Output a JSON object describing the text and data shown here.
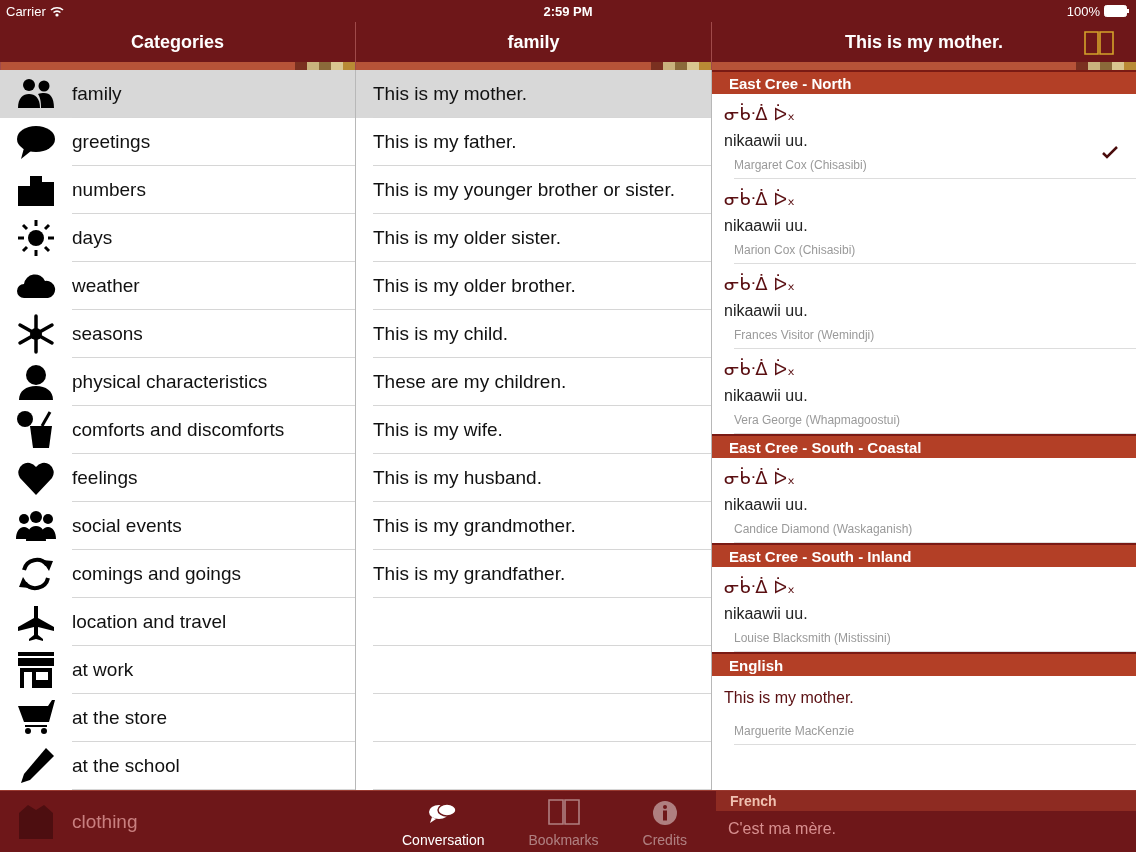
{
  "status_bar": {
    "carrier": "Carrier",
    "time": "2:59 PM",
    "battery": "100%"
  },
  "categories": {
    "title": "Categories",
    "items": [
      {
        "label": "family",
        "selected": true
      },
      {
        "label": "greetings",
        "selected": false
      },
      {
        "label": "numbers",
        "selected": false
      },
      {
        "label": "days",
        "selected": false
      },
      {
        "label": "weather",
        "selected": false
      },
      {
        "label": "seasons",
        "selected": false
      },
      {
        "label": "physical characteristics",
        "selected": false
      },
      {
        "label": "comforts and discomforts",
        "selected": false
      },
      {
        "label": "feelings",
        "selected": false
      },
      {
        "label": "social events",
        "selected": false
      },
      {
        "label": "comings and goings",
        "selected": false
      },
      {
        "label": "location and travel",
        "selected": false
      },
      {
        "label": "at work",
        "selected": false
      },
      {
        "label": "at the store",
        "selected": false
      },
      {
        "label": "at the school",
        "selected": false
      },
      {
        "label": "clothing",
        "selected": false
      }
    ]
  },
  "phrases": {
    "title": "family",
    "items": [
      {
        "label": "This is my mother.",
        "selected": true
      },
      {
        "label": "This is my father.",
        "selected": false
      },
      {
        "label": "This is my younger brother or sister.",
        "selected": false
      },
      {
        "label": "This is my older sister.",
        "selected": false
      },
      {
        "label": "This is my older brother.",
        "selected": false
      },
      {
        "label": "This is my child.",
        "selected": false
      },
      {
        "label": "These are my children.",
        "selected": false
      },
      {
        "label": "This is my wife.",
        "selected": false
      },
      {
        "label": "This is my husband.",
        "selected": false
      },
      {
        "label": "This is my grandmother.",
        "selected": false
      },
      {
        "label": "This is my grandfather.",
        "selected": false
      }
    ]
  },
  "detail": {
    "title": "This is my mother.",
    "sections": [
      {
        "title": "East Cree - North",
        "entries": [
          {
            "kind": "cree",
            "syllabics": "ᓂᑳᐧᐄ ᐆ᙮",
            "roman": "nikaawii uu.",
            "speaker": "Margaret Cox (Chisasibi)",
            "checked": true
          },
          {
            "kind": "cree",
            "syllabics": "ᓂᑳᐧᐄ ᐆ᙮",
            "roman": "nikaawii uu.",
            "speaker": "Marion Cox (Chisasibi)",
            "checked": false
          },
          {
            "kind": "cree",
            "syllabics": "ᓂᑳᐧᐄ ᐆ᙮",
            "roman": "nikaawii uu.",
            "speaker": "Frances Visitor (Wemindji)",
            "checked": false
          },
          {
            "kind": "cree",
            "syllabics": "ᓂᑳᐧᐄ ᐆ᙮",
            "roman": "nikaawii uu.",
            "speaker": "Vera George (Whapmagoostui)",
            "checked": false
          }
        ]
      },
      {
        "title": "East Cree - South - Coastal",
        "entries": [
          {
            "kind": "cree",
            "syllabics": "ᓂᑳᐧᐄ ᐆ᙮",
            "roman": "nikaawii uu.",
            "speaker": "Candice Diamond (Waskaganish)",
            "checked": false
          }
        ]
      },
      {
        "title": "East Cree - South - Inland",
        "entries": [
          {
            "kind": "cree",
            "syllabics": "ᓂᑳᐧᐄ ᐆ᙮",
            "roman": "nikaawii uu.",
            "speaker": "Louise Blacksmith (Mistissini)",
            "checked": false
          }
        ]
      },
      {
        "title": "English",
        "entries": [
          {
            "kind": "text",
            "text": "This is my mother.",
            "speaker": "Marguerite MacKenzie",
            "checked": false
          }
        ]
      },
      {
        "title": "French",
        "entries": [
          {
            "text": "C'est ma mère.",
            "checked": false
          }
        ]
      }
    ]
  },
  "tab_bar": [
    {
      "label": "Conversation",
      "selected": true
    },
    {
      "label": "Bookmarks",
      "selected": false
    },
    {
      "label": "Credits",
      "selected": false
    }
  ]
}
